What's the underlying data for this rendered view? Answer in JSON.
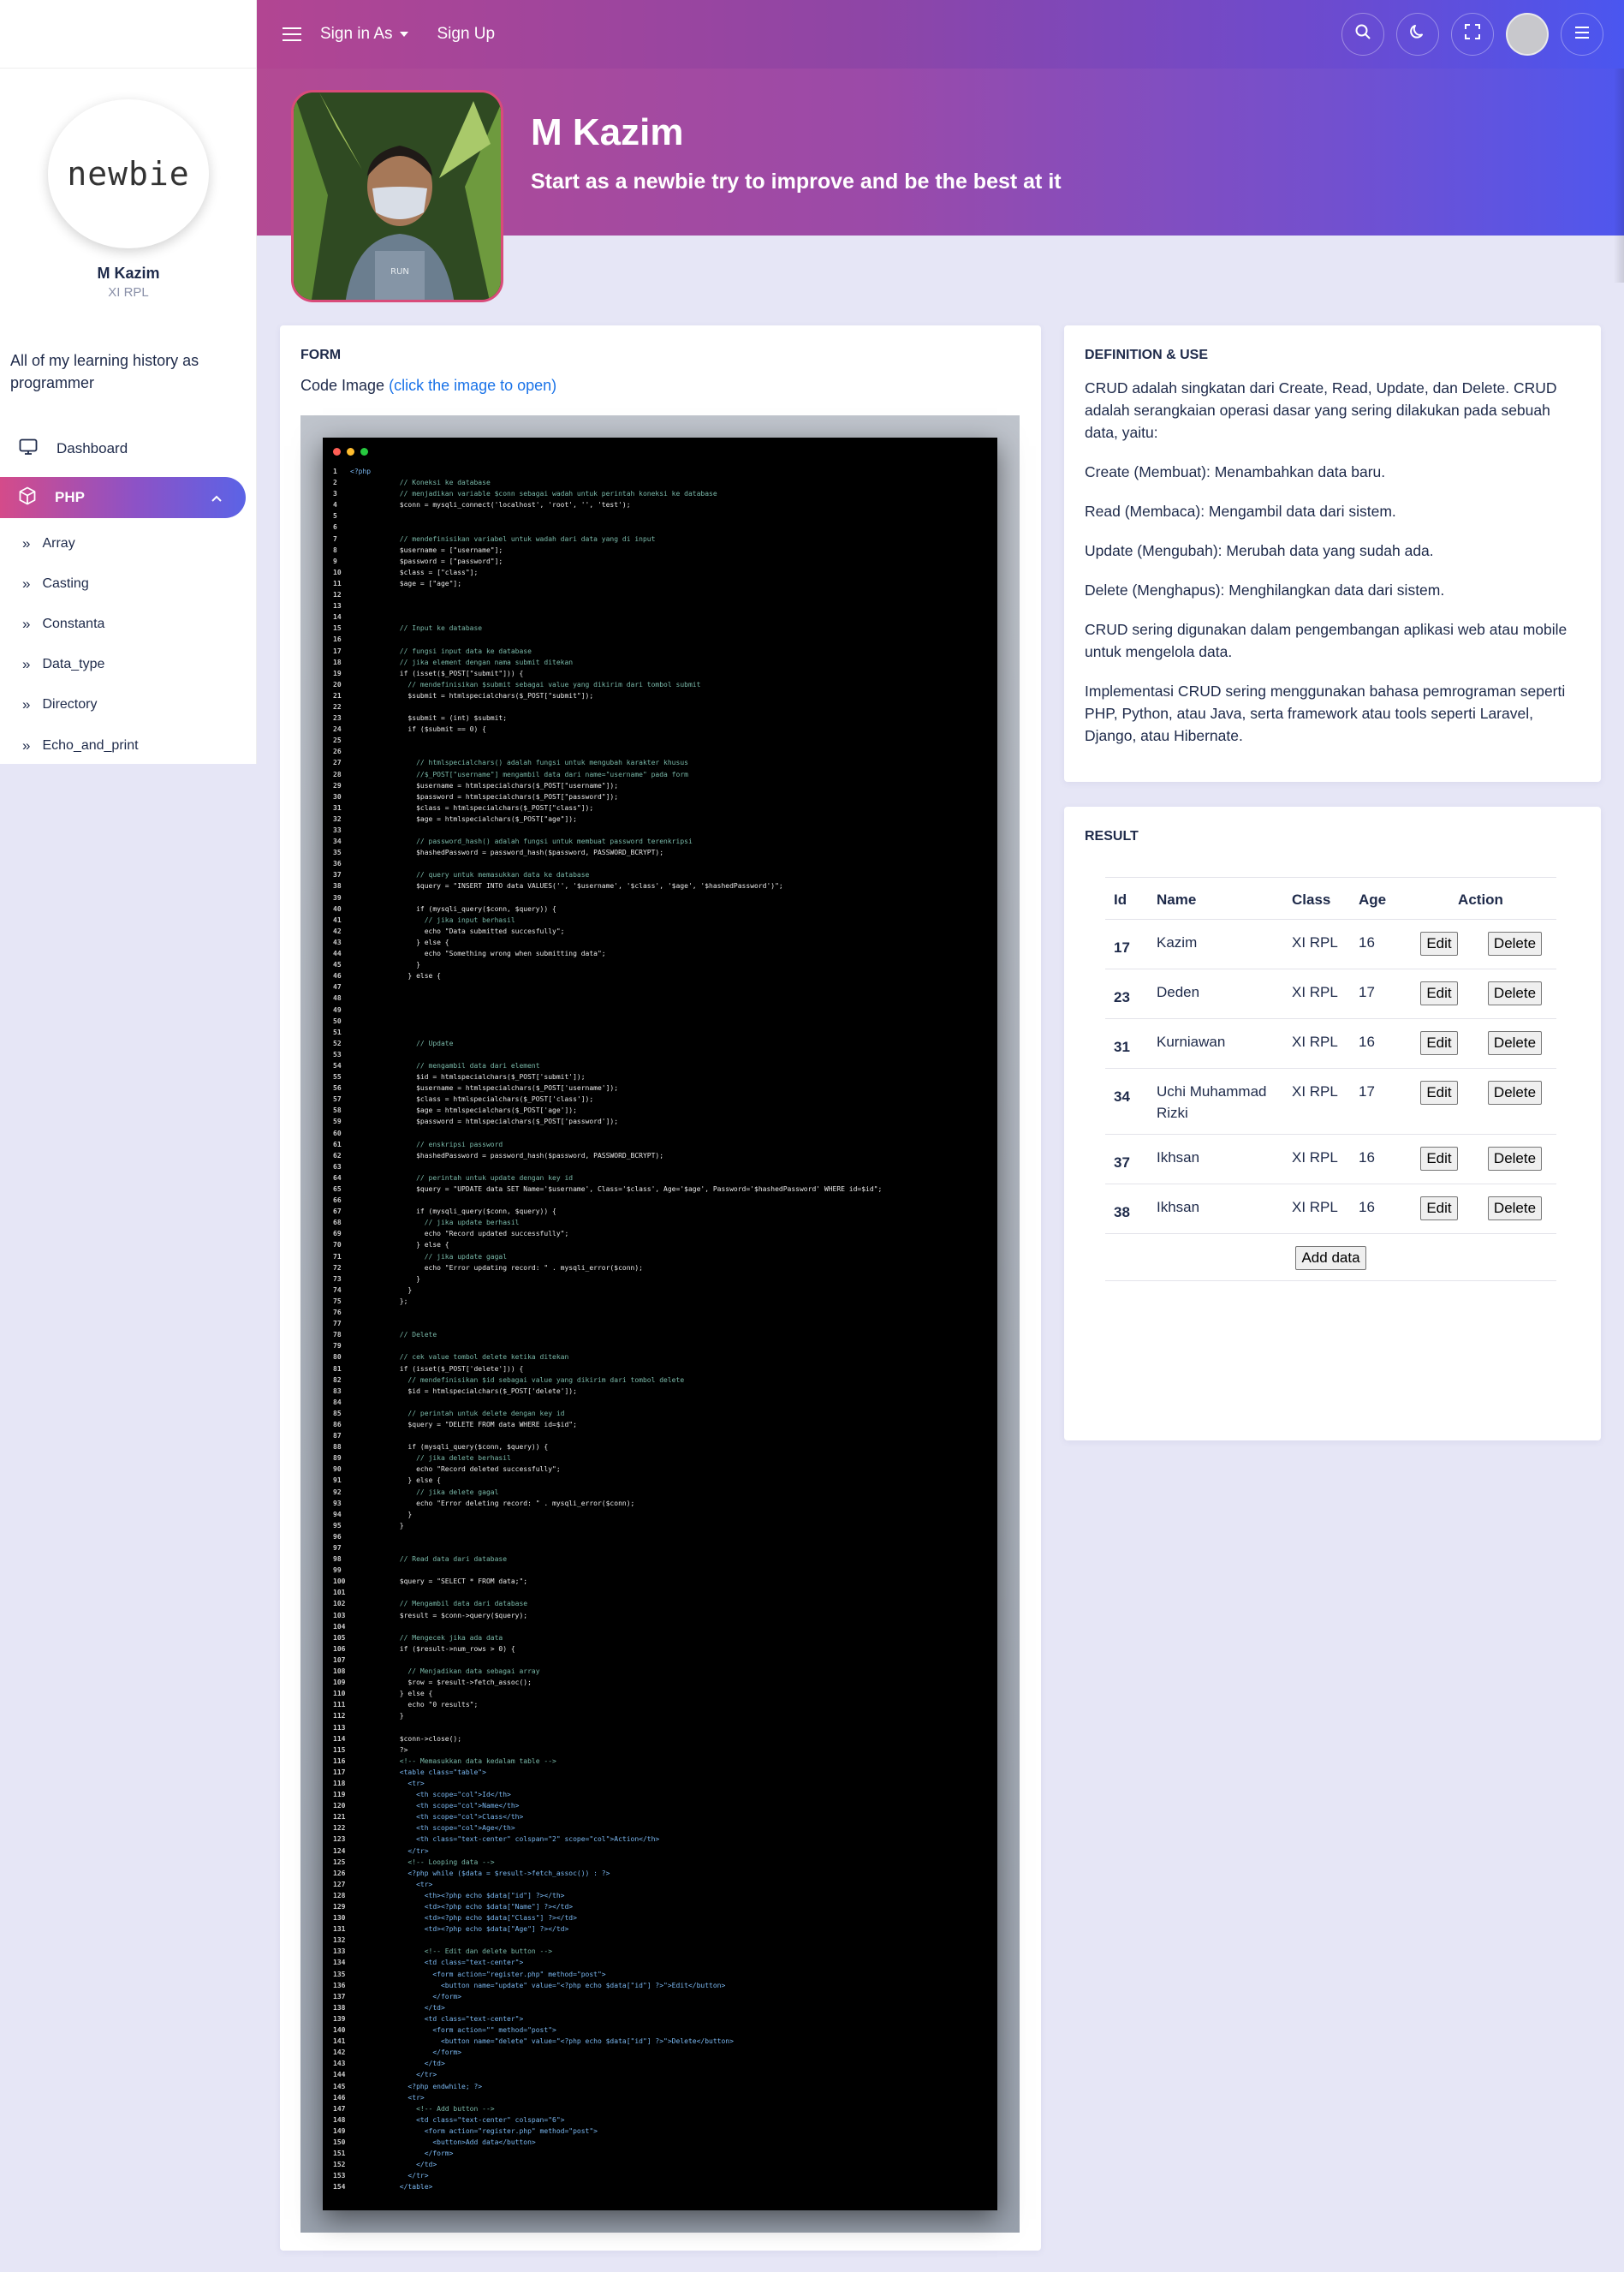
{
  "navbar": {
    "sign_in_label": "Sign in As",
    "sign_up_label": "Sign Up",
    "icons": [
      "menu-icon",
      "search-icon",
      "moon-icon",
      "fullscreen-icon",
      "avatar",
      "menu-icon"
    ]
  },
  "sidebar": {
    "logo_text": "newbie",
    "name": "M Kazim",
    "class": "XI RPL",
    "description": "All of my learning history as programmer",
    "items": [
      {
        "label": "Dashboard",
        "icon": "monitor-icon"
      },
      {
        "label": "PHP",
        "icon": "cube-icon",
        "active": true
      }
    ],
    "subitems": [
      "Array",
      "Casting",
      "Constanta",
      "Data_type",
      "Directory",
      "Echo_and_print"
    ]
  },
  "banner": {
    "title": "M Kazim",
    "subtitle": "Start as a newbie try to improve and be the best at it"
  },
  "form_card": {
    "title": "FORM",
    "code_label": "Code Image",
    "code_link": "(click the image to open)"
  },
  "definition_card": {
    "title": "DEFINITION & USE",
    "paragraphs": [
      "CRUD adalah singkatan dari Create, Read, Update, dan Delete. CRUD adalah serangkaian operasi dasar yang sering dilakukan pada sebuah data, yaitu:",
      "Create (Membuat): Menambahkan data baru.",
      "Read (Membaca): Mengambil data dari sistem.",
      "Update (Mengubah): Merubah data yang sudah ada.",
      "Delete (Menghapus): Menghilangkan data dari sistem.",
      "CRUD sering digunakan dalam pengembangan aplikasi web atau mobile untuk mengelola data.",
      "Implementasi CRUD sering menggunakan bahasa pemrograman seperti PHP, Python, atau Java, serta framework atau tools seperti Laravel, Django, atau Hibernate."
    ]
  },
  "result_card": {
    "title": "RESULT",
    "headers": [
      "Id",
      "Name",
      "Class",
      "Age",
      "Action"
    ],
    "rows": [
      {
        "id": "17",
        "name": "Kazim",
        "class": "XI RPL",
        "age": "16"
      },
      {
        "id": "23",
        "name": "Deden",
        "class": "XI RPL",
        "age": "17"
      },
      {
        "id": "31",
        "name": "Kurniawan",
        "class": "XI RPL",
        "age": "16"
      },
      {
        "id": "34",
        "name": "Uchi Muhammad Rizki",
        "class": "XI RPL",
        "age": "17"
      },
      {
        "id": "37",
        "name": "Ikhsan",
        "class": "XI RPL",
        "age": "16"
      },
      {
        "id": "38",
        "name": "Ikhsan",
        "class": "XI RPL",
        "age": "16"
      }
    ],
    "edit_label": "Edit",
    "delete_label": "Delete",
    "add_label": "Add data"
  },
  "code_lines": [
    "<?php",
    "            // Koneksi ke database",
    "            // menjadikan variable $conn sebagai wadah untuk perintah koneksi ke database",
    "            $conn = mysqli_connect('localhost', 'root', '', 'test');",
    "",
    "",
    "            // mendefinisikan variabel untuk wadah dari data yang di input",
    "            $username = [\"username\"];",
    "            $password = [\"password\"];",
    "            $class = [\"class\"];",
    "            $age = [\"age\"];",
    "",
    "",
    "",
    "            // Input ke database",
    "",
    "            // fungsi input data ke database",
    "            // jika element dengan nama submit ditekan",
    "            if (isset($_POST[\"submit\"])) {",
    "              // mendefinisikan $submit sebagai value yang dikirim dari tombol submit",
    "              $submit = htmlspecialchars($_POST[\"submit\"]);",
    "",
    "              $submit = (int) $submit;",
    "              if ($submit == 0) {",
    "",
    "",
    "                // htmlspecialchars() adalah fungsi untuk mengubah karakter khusus",
    "                //$_POST[\"username\"] mengambil data dari name=\"username\" pada form",
    "                $username = htmlspecialchars($_POST[\"username\"]);",
    "                $password = htmlspecialchars($_POST[\"password\"]);",
    "                $class = htmlspecialchars($_POST[\"class\"]);",
    "                $age = htmlspecialchars($_POST[\"age\"]);",
    "",
    "                // password_hash() adalah fungsi untuk membuat password terenkripsi",
    "                $hashedPassword = password_hash($password, PASSWORD_BCRYPT);",
    "",
    "                // query untuk memasukkan data ke database",
    "                $query = \"INSERT INTO data VALUES('', '$username', '$class', '$age', '$hashedPassword')\";",
    "",
    "                if (mysqli_query($conn, $query)) {",
    "                  // jika input berhasil",
    "                  echo \"Data submitted succesfully\";",
    "                } else {",
    "                  echo \"Something wrong when submitting data\";",
    "                }",
    "              } else {",
    "",
    "",
    "",
    "",
    "",
    "                // Update",
    "",
    "                // mengambil data dari element",
    "                $id = htmlspecialchars($_POST['submit']);",
    "                $username = htmlspecialchars($_POST['username']);",
    "                $class = htmlspecialchars($_POST['class']);",
    "                $age = htmlspecialchars($_POST['age']);",
    "                $password = htmlspecialchars($_POST['password']);",
    "",
    "                // enskripsi password",
    "                $hashedPassword = password_hash($password, PASSWORD_BCRYPT);",
    "",
    "                // perintah untuk update dengan key id",
    "                $query = \"UPDATE data SET Name='$username', Class='$class', Age='$age', Password='$hashedPassword' WHERE id=$id\";",
    "",
    "                if (mysqli_query($conn, $query)) {",
    "                  // jika update berhasil",
    "                  echo \"Record updated successfully\";",
    "                } else {",
    "                  // jika update gagal",
    "                  echo \"Error updating record: \" . mysqli_error($conn);",
    "                }",
    "              }",
    "            };",
    "",
    "",
    "            // Delete",
    "",
    "            // cek value tombol delete ketika ditekan",
    "            if (isset($_POST['delete'])) {",
    "              // mendefinisikan $id sebagai value yang dikirim dari tombol delete",
    "              $id = htmlspecialchars($_POST['delete']);",
    "",
    "              // perintah untuk delete dengan key id",
    "              $query = \"DELETE FROM data WHERE id=$id\";",
    "",
    "              if (mysqli_query($conn, $query)) {",
    "                // jika delete berhasil",
    "                echo \"Record deleted successfully\";",
    "              } else {",
    "                // jika delete gagal",
    "                echo \"Error deleting record: \" . mysqli_error($conn);",
    "              }",
    "            }",
    "",
    "",
    "            // Read data dari database",
    "",
    "            $query = \"SELECT * FROM data;\";",
    "",
    "            // Mengambil data dari database",
    "            $result = $conn->query($query);",
    "",
    "            // Mengecek jika ada data",
    "            if ($result->num_rows > 0) {",
    "",
    "              // Menjadikan data sebagai array",
    "              $row = $result->fetch_assoc();",
    "            } else {",
    "              echo \"0 results\";",
    "            }",
    "",
    "            $conn->close();",
    "            ?>",
    "            <!-- Memasukkan data kedalam table -->",
    "            <table class=\"table\">",
    "              <tr>",
    "                <th scope=\"col\">Id</th>",
    "                <th scope=\"col\">Name</th>",
    "                <th scope=\"col\">Class</th>",
    "                <th scope=\"col\">Age</th>",
    "                <th class=\"text-center\" colspan=\"2\" scope=\"col\">Action</th>",
    "              </tr>",
    "              <!-- Looping data -->",
    "              <?php while ($data = $result->fetch_assoc()) : ?>",
    "                <tr>",
    "                  <th><?php echo $data[\"id\"] ?></th>",
    "                  <td><?php echo $data[\"Name\"] ?></td>",
    "                  <td><?php echo $data[\"Class\"] ?></td>",
    "                  <td><?php echo $data[\"Age\"] ?></td>",
    "",
    "                  <!-- Edit dan delete button -->",
    "                  <td class=\"text-center\">",
    "                    <form action=\"register.php\" method=\"post\">",
    "                      <button name=\"update\" value=\"<?php echo $data[\"id\"] ?>\">Edit</button>",
    "                    </form>",
    "                  </td>",
    "                  <td class=\"text-center\">",
    "                    <form action=\"\" method=\"post\">",
    "                      <button name=\"delete\" value=\"<?php echo $data[\"id\"] ?>\">Delete</button>",
    "                    </form>",
    "                  </td>",
    "                </tr>",
    "              <?php endwhile; ?>",
    "              <tr>",
    "                <!-- Add button -->",
    "                <td class=\"text-center\" colspan=\"6\">",
    "                  <form action=\"register.php\" method=\"post\">",
    "                    <button>Add data</button>",
    "                  </form>",
    "                </td>",
    "              </tr>",
    "            </table>"
  ]
}
